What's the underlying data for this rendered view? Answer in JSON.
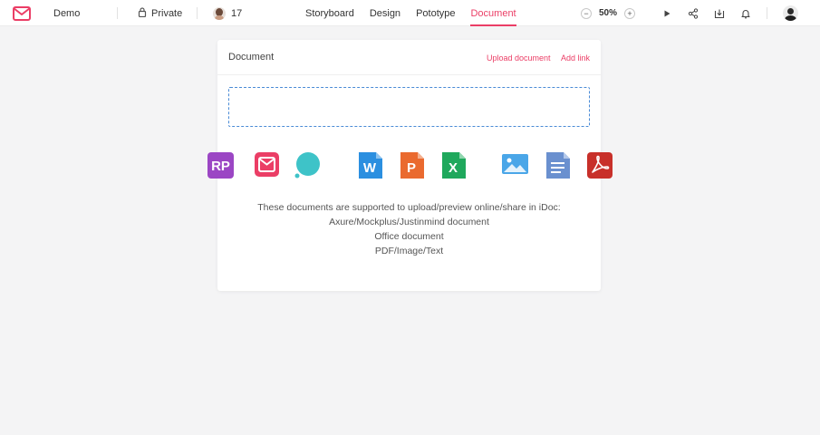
{
  "header": {
    "logo_icon": "mockplus-m-logo-icon",
    "project_name": "Demo",
    "privacy_label": "Private",
    "member_count": "17",
    "tabs": [
      {
        "label": "Storyboard",
        "active": false
      },
      {
        "label": "Design",
        "active": false
      },
      {
        "label": "Pototype",
        "active": false
      },
      {
        "label": "Document",
        "active": true
      }
    ],
    "zoom": {
      "minus": "−",
      "value": "50%",
      "plus": "+"
    },
    "actions": [
      "play-icon",
      "share-icon",
      "download-icon",
      "bell-icon"
    ]
  },
  "document_panel": {
    "title": "Document",
    "upload_label": "Upload document",
    "add_link_label": "Add link",
    "file_types": [
      {
        "name": "axure-rp-icon",
        "text": "RP",
        "color": "#9b46c4"
      },
      {
        "name": "mockplus-icon",
        "color": "#eb3e66"
      },
      {
        "name": "justinmind-icon",
        "color": "#3ec3c8"
      },
      {
        "name": "word-icon",
        "text": "W",
        "color": "#2b8fe0"
      },
      {
        "name": "powerpoint-icon",
        "text": "P",
        "color": "#ea6a2f"
      },
      {
        "name": "excel-icon",
        "text": "X",
        "color": "#1fa85c"
      },
      {
        "name": "image-icon",
        "color": "#4aa6e8"
      },
      {
        "name": "text-file-icon",
        "color": "#6a90cf"
      },
      {
        "name": "pdf-icon",
        "color": "#c8302a"
      }
    ],
    "supported_heading": "These documents are supported to upload/preview online/share in iDoc:",
    "supported_lines": [
      "Axure/Mockplus/Justinmind document",
      "Office document",
      "PDF/Image/Text"
    ]
  },
  "colors": {
    "accent": "#eb3e66",
    "dropzone_border": "#4a8bd6",
    "background": "#f4f4f5"
  }
}
